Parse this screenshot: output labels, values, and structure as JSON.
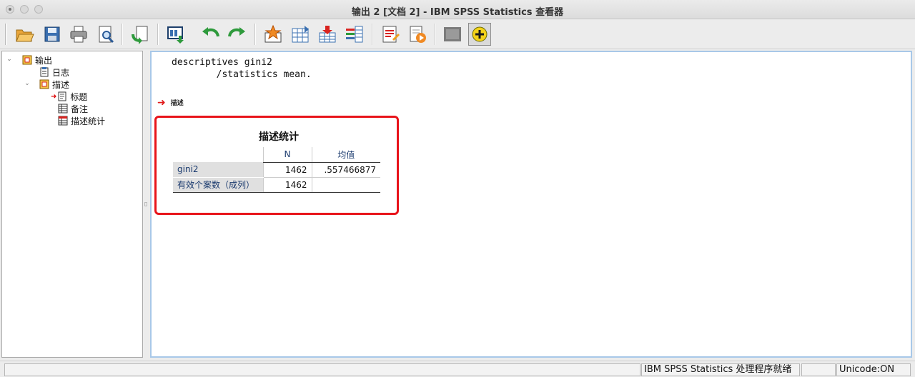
{
  "window": {
    "title": "输出 2 [文档 2] - IBM SPSS Statistics 查看器"
  },
  "toolbar": {
    "buttons": [
      {
        "name": "open-icon"
      },
      {
        "name": "save-icon"
      },
      {
        "name": "print-icon"
      },
      {
        "name": "print-preview-icon"
      },
      {
        "name": "export-icon"
      },
      {
        "name": "recall-dialog-icon"
      },
      {
        "name": "undo-icon"
      },
      {
        "name": "redo-icon"
      },
      {
        "name": "goto-data-icon"
      },
      {
        "name": "goto-case-icon"
      },
      {
        "name": "goto-variable-icon"
      },
      {
        "name": "variables-icon"
      },
      {
        "name": "insert-title-icon"
      },
      {
        "name": "run-script-icon"
      },
      {
        "name": "hide-output-icon"
      },
      {
        "name": "show-output-icon"
      }
    ]
  },
  "outline": {
    "root": "输出",
    "log": "日志",
    "descriptives": "描述",
    "title_item": "标题",
    "notes_item": "备注",
    "stats_item": "描述统计"
  },
  "content": {
    "syntax_line1": "descriptives gini2",
    "syntax_line2": "        /statistics mean.",
    "section_heading": "描述",
    "table": {
      "title": "描述统计",
      "columns": [
        "",
        "N",
        "均值"
      ],
      "rows": [
        {
          "label": "gini2",
          "n": "1462",
          "mean": ".557466877"
        },
        {
          "label": "有效个案数（成列）",
          "n": "1462",
          "mean": ""
        }
      ]
    }
  },
  "statusbar": {
    "left": "",
    "processor": "IBM SPSS Statistics 处理程序就绪",
    "encoding": "Unicode:ON"
  },
  "colors": {
    "highlight_border": "#e8141b",
    "pane_border": "#a8c8e8"
  }
}
